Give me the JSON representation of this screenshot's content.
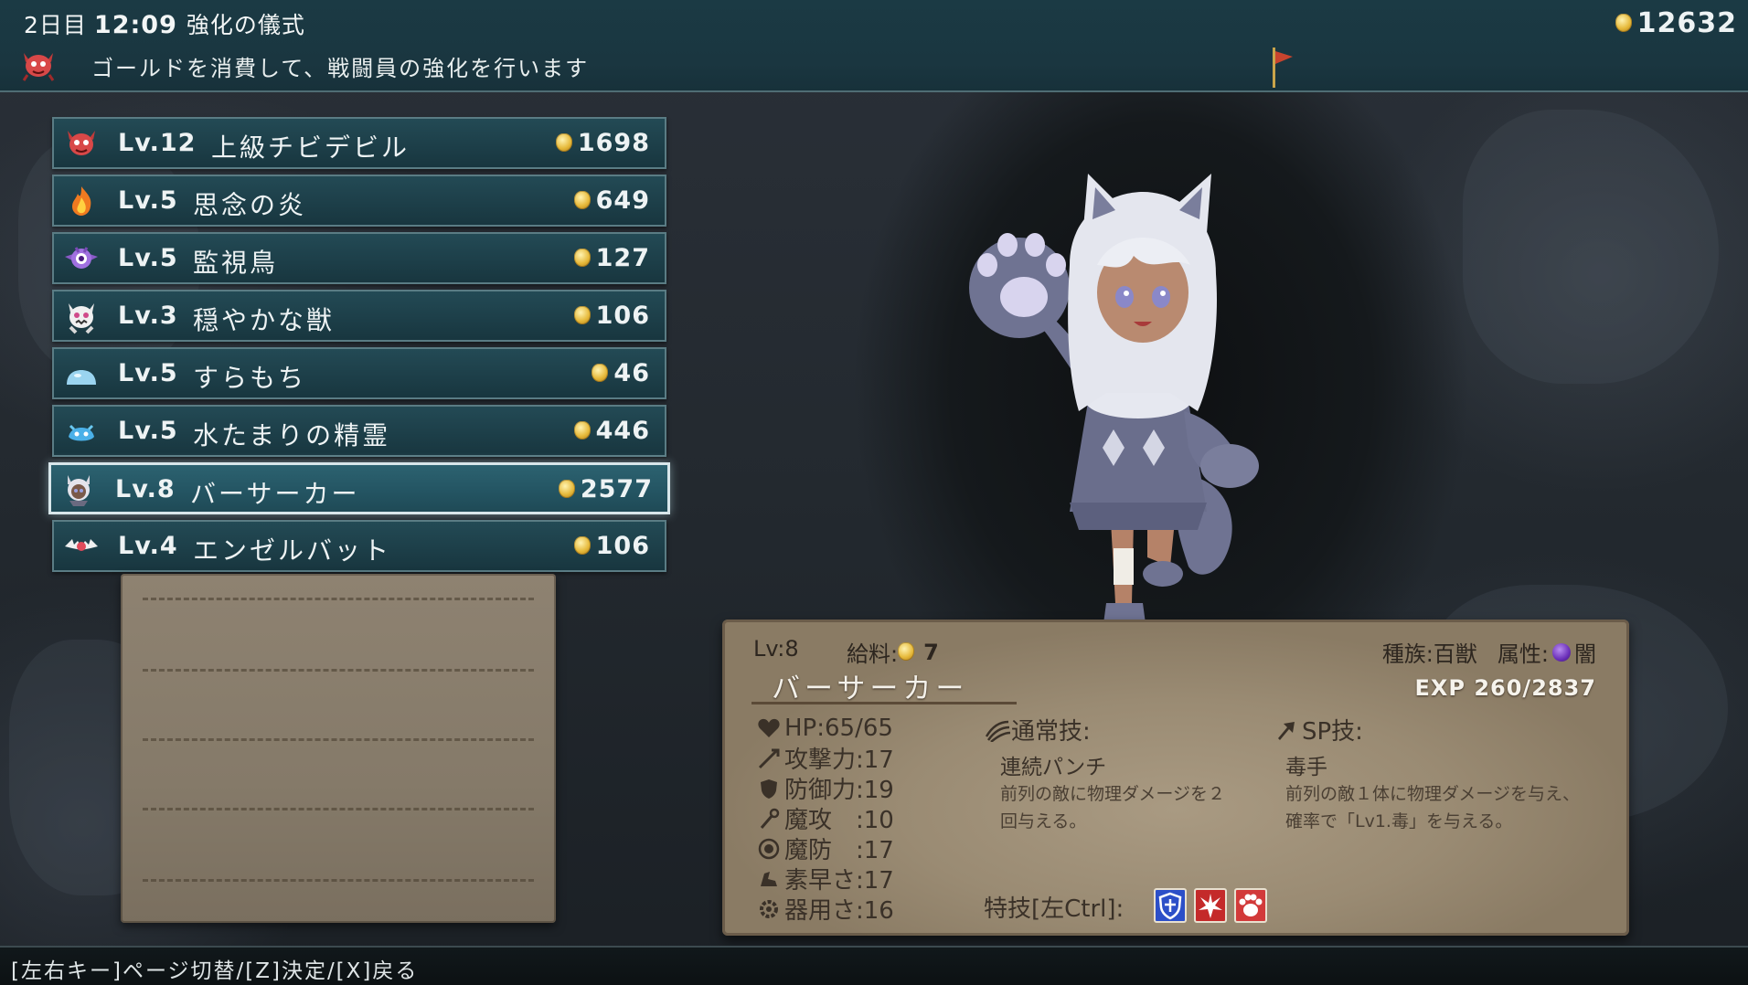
{
  "header": {
    "day": "2日目",
    "time": "12:09",
    "screen_title": "強化の儀式",
    "description": "ゴールドを消費して、戦闘員の強化を行います",
    "gold_total": "12632"
  },
  "units": [
    {
      "level": "Lv.12",
      "name": "上級チビデビル",
      "cost": "1698",
      "icon": "red-devil-icon"
    },
    {
      "level": "Lv.5",
      "name": "思念の炎",
      "cost": "649",
      "icon": "flame-icon"
    },
    {
      "level": "Lv.5",
      "name": "監視鳥",
      "cost": "127",
      "icon": "watch-bird-icon"
    },
    {
      "level": "Lv.3",
      "name": "穏やかな獣",
      "cost": "106",
      "icon": "gentle-beast-icon"
    },
    {
      "level": "Lv.5",
      "name": "すらもち",
      "cost": "46",
      "icon": "slime-icon"
    },
    {
      "level": "Lv.5",
      "name": "水たまりの精霊",
      "cost": "446",
      "icon": "water-spirit-icon"
    },
    {
      "level": "Lv.8",
      "name": "バーサーカー",
      "cost": "2577",
      "icon": "berserker-icon",
      "selected": true
    },
    {
      "level": "Lv.4",
      "name": "エンゼルバット",
      "cost": "106",
      "icon": "angel-bat-icon"
    }
  ],
  "detail": {
    "level": "Lv:8",
    "salary_label": "給料:",
    "salary": "7",
    "name": "バーサーカー",
    "race": "種族:百獣",
    "attribute_label": "属性:",
    "attribute": "闇",
    "exp": "EXP 260/2837",
    "stats": {
      "hp": "HP:65/65",
      "attack": "攻撃力:17",
      "defense": "防御力:19",
      "magic_attack": "魔攻　:10",
      "magic_defense": "魔防　:17",
      "speed": "素早さ:17",
      "dexterity": "器用さ:16"
    },
    "normal_skill": {
      "heading": "通常技:",
      "name": "連続パンチ",
      "desc_line1": "前列の敵に物理ダメージを２",
      "desc_line2": "回与える。"
    },
    "sp_skill": {
      "heading": "SP技:",
      "name": "毒手",
      "desc_line1": "前列の敵１体に物理ダメージを与え、",
      "desc_line2": "確率で「Lv1.毒」を与える。"
    },
    "traits_label": "特技[左Ctrl]:",
    "traits": [
      {
        "icon": "shield-trait-icon",
        "color": "#2c4fc8"
      },
      {
        "icon": "crimson-burst-trait-icon",
        "color": "#c42a2a"
      },
      {
        "icon": "paw-trait-icon",
        "color": "#d23a3a"
      }
    ]
  },
  "footer": {
    "hint": "[左右キー]ページ切替/[Z]決定/[X]戻る"
  }
}
